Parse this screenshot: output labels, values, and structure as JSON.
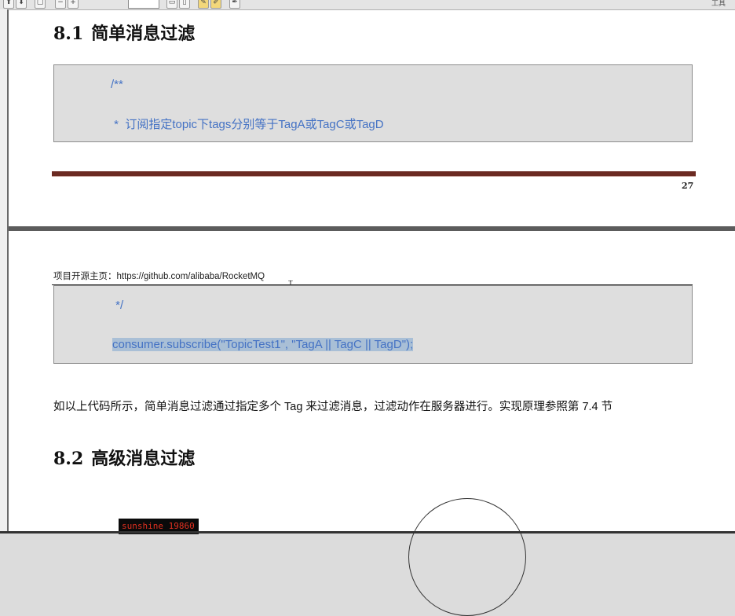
{
  "toolbar": {
    "zoom_value": "",
    "right_label": "工具"
  },
  "page1": {
    "section_number": "8.1",
    "section_title": "简单消息过滤",
    "code": {
      "line1": "/**",
      "line2": " *  订阅指定topic下tags分别等于TagA或TagC或TagD"
    },
    "page_number": "27"
  },
  "page2": {
    "header_text": "项目开源主页：https://github.com/alibaba/RocketMQ",
    "code": {
      "line1": " */",
      "line2_prefix": "consumer.subscribe(",
      "line2_args": "\"TopicTest1\", \"TagA || TagC || TagD\"",
      "line2_suffix": ");"
    },
    "body_text": "如以上代码所示，简单消息过滤通过指定多个 Tag 来过滤消息，过滤动作在服务器进行。实现原理参照第 7.4 节",
    "section_number": "8.2",
    "section_title": "高级消息过滤",
    "watermark": "sunshine 19860"
  }
}
